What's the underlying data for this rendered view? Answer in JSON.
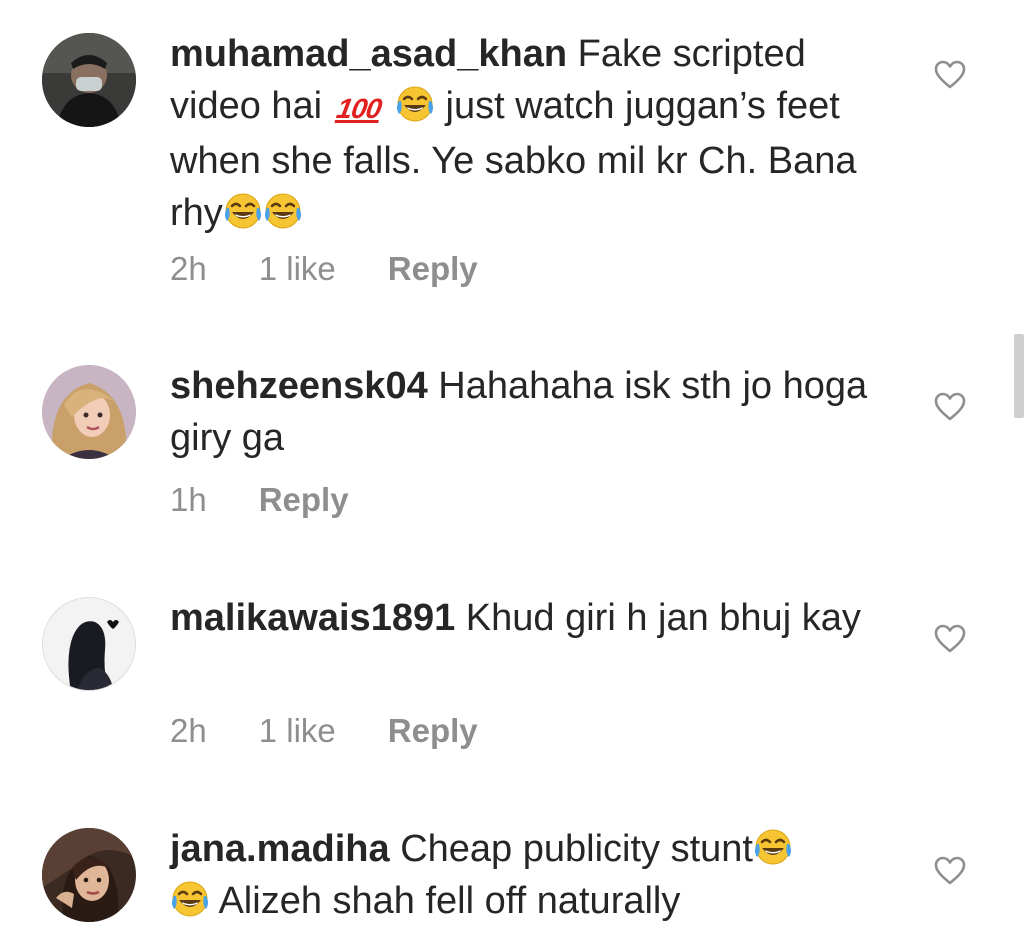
{
  "comments": [
    {
      "username": "muhamad_asad_khan",
      "text_parts": [
        " Fake scripted video hai ",
        " just watch juggan’s feet when she falls. Ye sabko mil kr Ch. Bana rhy"
      ],
      "hundred": "100",
      "time": "2h",
      "likes": "1 like",
      "reply": "Reply"
    },
    {
      "username": "shehzeensk04",
      "text": " Hahahaha isk sth jo hoga giry ga",
      "time": "1h",
      "reply": "Reply"
    },
    {
      "username": "malikawais1891",
      "text": " Khud giri h jan bhuj kay",
      "time": "2h",
      "likes": "1 like",
      "reply": "Reply"
    },
    {
      "username": "jana.madiha",
      "text_parts": [
        " Cheap publicity stunt",
        " Alizeh shah fell off naturally"
      ]
    }
  ],
  "icons": {
    "like": "heart-outline-icon",
    "emoji": "face-with-tears-of-joy-emoji",
    "hundred": "hundred-points-emoji"
  },
  "colors": {
    "text": "#262626",
    "meta": "#8e8e8e",
    "hundred": "#e0211f",
    "emoji": "#f7c531"
  }
}
